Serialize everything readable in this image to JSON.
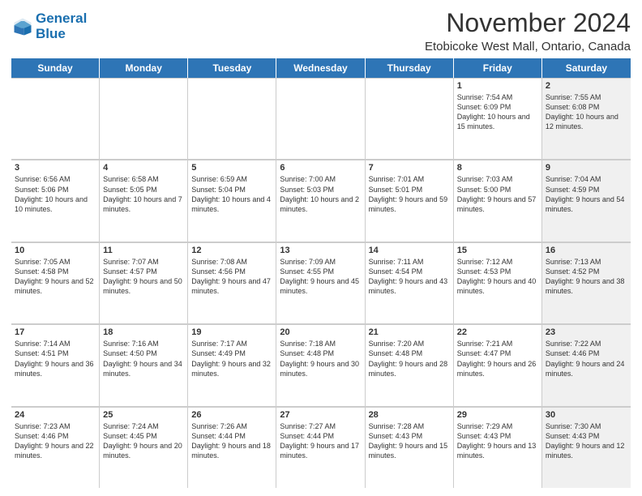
{
  "header": {
    "logo_line1": "General",
    "logo_line2": "Blue",
    "month_title": "November 2024",
    "location": "Etobicoke West Mall, Ontario, Canada"
  },
  "days_of_week": [
    "Sunday",
    "Monday",
    "Tuesday",
    "Wednesday",
    "Thursday",
    "Friday",
    "Saturday"
  ],
  "rows": [
    [
      {
        "day": "",
        "info": "",
        "shaded": false
      },
      {
        "day": "",
        "info": "",
        "shaded": false
      },
      {
        "day": "",
        "info": "",
        "shaded": false
      },
      {
        "day": "",
        "info": "",
        "shaded": false
      },
      {
        "day": "",
        "info": "",
        "shaded": false
      },
      {
        "day": "1",
        "info": "Sunrise: 7:54 AM\nSunset: 6:09 PM\nDaylight: 10 hours and 15 minutes.",
        "shaded": false
      },
      {
        "day": "2",
        "info": "Sunrise: 7:55 AM\nSunset: 6:08 PM\nDaylight: 10 hours and 12 minutes.",
        "shaded": true
      }
    ],
    [
      {
        "day": "3",
        "info": "Sunrise: 6:56 AM\nSunset: 5:06 PM\nDaylight: 10 hours and 10 minutes.",
        "shaded": false
      },
      {
        "day": "4",
        "info": "Sunrise: 6:58 AM\nSunset: 5:05 PM\nDaylight: 10 hours and 7 minutes.",
        "shaded": false
      },
      {
        "day": "5",
        "info": "Sunrise: 6:59 AM\nSunset: 5:04 PM\nDaylight: 10 hours and 4 minutes.",
        "shaded": false
      },
      {
        "day": "6",
        "info": "Sunrise: 7:00 AM\nSunset: 5:03 PM\nDaylight: 10 hours and 2 minutes.",
        "shaded": false
      },
      {
        "day": "7",
        "info": "Sunrise: 7:01 AM\nSunset: 5:01 PM\nDaylight: 9 hours and 59 minutes.",
        "shaded": false
      },
      {
        "day": "8",
        "info": "Sunrise: 7:03 AM\nSunset: 5:00 PM\nDaylight: 9 hours and 57 minutes.",
        "shaded": false
      },
      {
        "day": "9",
        "info": "Sunrise: 7:04 AM\nSunset: 4:59 PM\nDaylight: 9 hours and 54 minutes.",
        "shaded": true
      }
    ],
    [
      {
        "day": "10",
        "info": "Sunrise: 7:05 AM\nSunset: 4:58 PM\nDaylight: 9 hours and 52 minutes.",
        "shaded": false
      },
      {
        "day": "11",
        "info": "Sunrise: 7:07 AM\nSunset: 4:57 PM\nDaylight: 9 hours and 50 minutes.",
        "shaded": false
      },
      {
        "day": "12",
        "info": "Sunrise: 7:08 AM\nSunset: 4:56 PM\nDaylight: 9 hours and 47 minutes.",
        "shaded": false
      },
      {
        "day": "13",
        "info": "Sunrise: 7:09 AM\nSunset: 4:55 PM\nDaylight: 9 hours and 45 minutes.",
        "shaded": false
      },
      {
        "day": "14",
        "info": "Sunrise: 7:11 AM\nSunset: 4:54 PM\nDaylight: 9 hours and 43 minutes.",
        "shaded": false
      },
      {
        "day": "15",
        "info": "Sunrise: 7:12 AM\nSunset: 4:53 PM\nDaylight: 9 hours and 40 minutes.",
        "shaded": false
      },
      {
        "day": "16",
        "info": "Sunrise: 7:13 AM\nSunset: 4:52 PM\nDaylight: 9 hours and 38 minutes.",
        "shaded": true
      }
    ],
    [
      {
        "day": "17",
        "info": "Sunrise: 7:14 AM\nSunset: 4:51 PM\nDaylight: 9 hours and 36 minutes.",
        "shaded": false
      },
      {
        "day": "18",
        "info": "Sunrise: 7:16 AM\nSunset: 4:50 PM\nDaylight: 9 hours and 34 minutes.",
        "shaded": false
      },
      {
        "day": "19",
        "info": "Sunrise: 7:17 AM\nSunset: 4:49 PM\nDaylight: 9 hours and 32 minutes.",
        "shaded": false
      },
      {
        "day": "20",
        "info": "Sunrise: 7:18 AM\nSunset: 4:48 PM\nDaylight: 9 hours and 30 minutes.",
        "shaded": false
      },
      {
        "day": "21",
        "info": "Sunrise: 7:20 AM\nSunset: 4:48 PM\nDaylight: 9 hours and 28 minutes.",
        "shaded": false
      },
      {
        "day": "22",
        "info": "Sunrise: 7:21 AM\nSunset: 4:47 PM\nDaylight: 9 hours and 26 minutes.",
        "shaded": false
      },
      {
        "day": "23",
        "info": "Sunrise: 7:22 AM\nSunset: 4:46 PM\nDaylight: 9 hours and 24 minutes.",
        "shaded": true
      }
    ],
    [
      {
        "day": "24",
        "info": "Sunrise: 7:23 AM\nSunset: 4:46 PM\nDaylight: 9 hours and 22 minutes.",
        "shaded": false
      },
      {
        "day": "25",
        "info": "Sunrise: 7:24 AM\nSunset: 4:45 PM\nDaylight: 9 hours and 20 minutes.",
        "shaded": false
      },
      {
        "day": "26",
        "info": "Sunrise: 7:26 AM\nSunset: 4:44 PM\nDaylight: 9 hours and 18 minutes.",
        "shaded": false
      },
      {
        "day": "27",
        "info": "Sunrise: 7:27 AM\nSunset: 4:44 PM\nDaylight: 9 hours and 17 minutes.",
        "shaded": false
      },
      {
        "day": "28",
        "info": "Sunrise: 7:28 AM\nSunset: 4:43 PM\nDaylight: 9 hours and 15 minutes.",
        "shaded": false
      },
      {
        "day": "29",
        "info": "Sunrise: 7:29 AM\nSunset: 4:43 PM\nDaylight: 9 hours and 13 minutes.",
        "shaded": false
      },
      {
        "day": "30",
        "info": "Sunrise: 7:30 AM\nSunset: 4:43 PM\nDaylight: 9 hours and 12 minutes.",
        "shaded": true
      }
    ]
  ]
}
